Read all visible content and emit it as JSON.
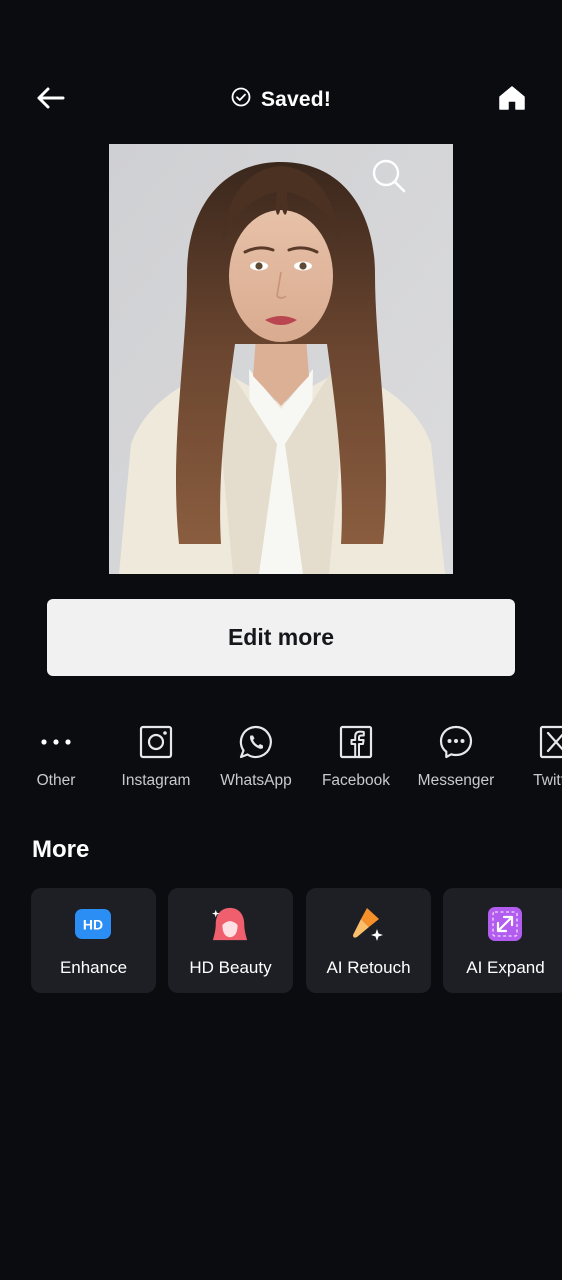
{
  "topbar": {
    "back_icon": "arrow-left-icon",
    "status_icon": "check-circle-icon",
    "status_text": "Saved!",
    "home_icon": "home-icon"
  },
  "preview": {
    "zoom_icon": "magnifier-icon"
  },
  "actions": {
    "edit_label": "Edit more"
  },
  "share": [
    {
      "label": "Other",
      "icon": "more-dots-icon"
    },
    {
      "label": "Instagram",
      "icon": "instagram-icon"
    },
    {
      "label": "WhatsApp",
      "icon": "whatsapp-icon"
    },
    {
      "label": "Facebook",
      "icon": "facebook-icon"
    },
    {
      "label": "Messenger",
      "icon": "messenger-icon"
    },
    {
      "label": "Twitter",
      "icon": "x-twitter-icon"
    }
  ],
  "more": {
    "title": "More",
    "tools": [
      {
        "label": "Enhance",
        "icon": "hd-icon",
        "icon_text": "HD",
        "color": "#2b8ef5"
      },
      {
        "label": "HD Beauty",
        "icon": "beauty-face-icon",
        "color": "#f0606e"
      },
      {
        "label": "AI Retouch",
        "icon": "brush-sparkle-icon",
        "color": "#f5902b"
      },
      {
        "label": "AI Expand",
        "icon": "expand-arrows-icon",
        "color": "#b35cf0"
      }
    ]
  },
  "colors": {
    "background": "#0b0c10",
    "card": "#1d1f25",
    "button": "#f1f1f1"
  }
}
